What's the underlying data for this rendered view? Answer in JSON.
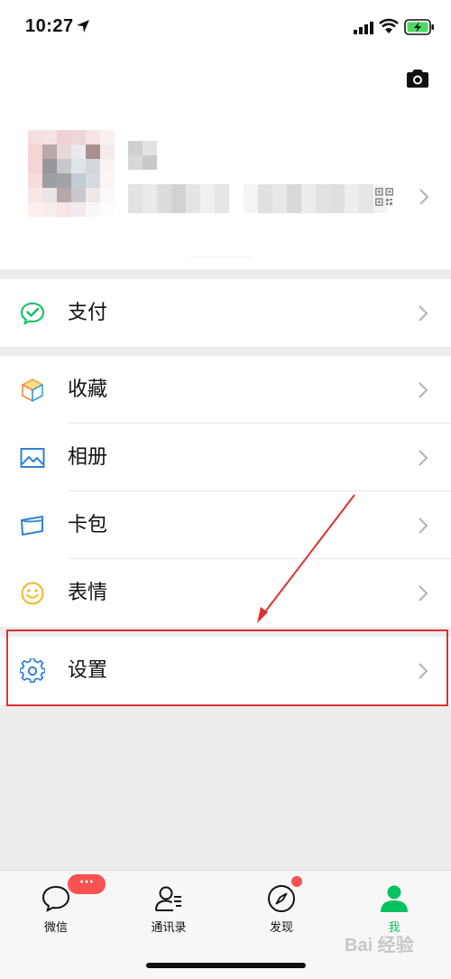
{
  "status_bar": {
    "time": "10:27"
  },
  "menu": {
    "pay": {
      "label": "支付"
    },
    "favorites": {
      "label": "收藏"
    },
    "album": {
      "label": "相册"
    },
    "cards": {
      "label": "卡包"
    },
    "stickers": {
      "label": "表情"
    },
    "settings": {
      "label": "设置"
    }
  },
  "tabbar": {
    "chats": {
      "label": "微信",
      "badge": "···"
    },
    "contacts": {
      "label": "通讯录"
    },
    "discover": {
      "label": "发现"
    },
    "me": {
      "label": "我"
    }
  },
  "watermark": "Bai 经验",
  "colors": {
    "accent": "#07c160",
    "badge": "#fa5151",
    "annotation": "#e03030"
  }
}
